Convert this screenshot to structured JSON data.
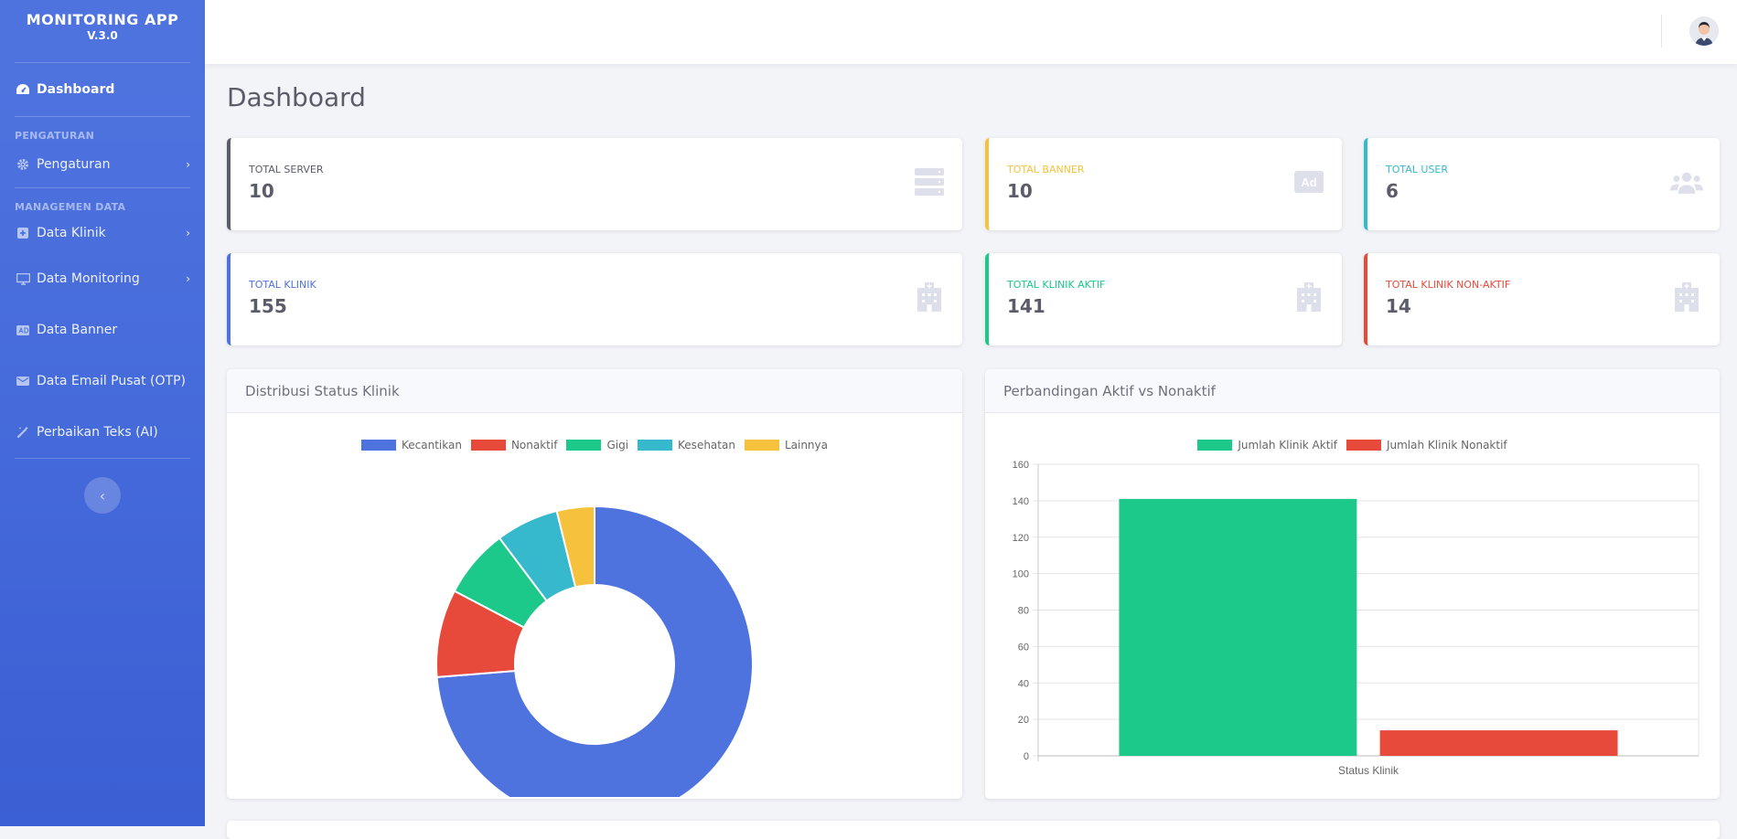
{
  "app": {
    "title": "MONITORING APP",
    "version": "V.3.0"
  },
  "sidebar": {
    "dashboard": "Dashboard",
    "heading_settings": "PENGATURAN",
    "settings": "Pengaturan",
    "heading_data": "MANAGEMEN DATA",
    "items": [
      {
        "label": "Data Klinik",
        "icon": "plus-square-icon"
      },
      {
        "label": "Data Monitoring",
        "icon": "monitor-icon"
      },
      {
        "label": "Data Banner",
        "icon": "ad-icon"
      },
      {
        "label": "Data Email Pusat (OTP)",
        "icon": "envelope-icon"
      },
      {
        "label": "Perbaikan Teks (AI)",
        "icon": "magic-icon"
      }
    ],
    "toggle_icon": "‹"
  },
  "page": {
    "title": "Dashboard"
  },
  "stats": [
    {
      "label": "TOTAL SERVER",
      "value": "10",
      "color": "#5a5c69",
      "icon": "server-icon"
    },
    {
      "label": "TOTAL BANNER",
      "value": "10",
      "color": "#f6c23e",
      "icon": "ad-icon"
    },
    {
      "label": "TOTAL USER",
      "value": "6",
      "color": "#36b9cc",
      "icon": "users-icon"
    },
    {
      "label": "TOTAL KLINIK",
      "value": "155",
      "color": "#4e73df",
      "icon": "hospital-icon"
    },
    {
      "label": "TOTAL KLINIK AKTIF",
      "value": "141",
      "color": "#1cc88a",
      "icon": "hospital-icon"
    },
    {
      "label": "TOTAL KLINIK NON-AKTIF",
      "value": "14",
      "color": "#e74a3b",
      "icon": "hospital-icon"
    }
  ],
  "charts": {
    "donut_title": "Distribusi Status Klinik",
    "bar_title": "Perbandingan Aktif vs Nonaktif"
  },
  "chart_data": [
    {
      "type": "pie",
      "title": "Distribusi Status Klinik",
      "labels": [
        "Kecantikan",
        "Nonaktif",
        "Gigi",
        "Kesehatan",
        "Lainnya"
      ],
      "values": [
        115,
        14,
        11,
        10,
        6
      ],
      "colors": [
        "#4e73df",
        "#e74a3b",
        "#1cc88a",
        "#36b9cc",
        "#f6c23e"
      ],
      "legend": "top"
    },
    {
      "type": "bar",
      "title": "Perbandingan Aktif vs Nonaktif",
      "categories": [
        "Status Klinik"
      ],
      "series": [
        {
          "name": "Jumlah Klinik Aktif",
          "values": [
            141
          ],
          "color": "#1cc88a"
        },
        {
          "name": "Jumlah Klinik Nonaktif",
          "values": [
            14
          ],
          "color": "#e74a3b"
        }
      ],
      "ylim": [
        0,
        160
      ],
      "yticks": [
        0,
        20,
        40,
        60,
        80,
        100,
        120,
        140,
        160
      ],
      "grid": true,
      "legend": "top"
    }
  ]
}
